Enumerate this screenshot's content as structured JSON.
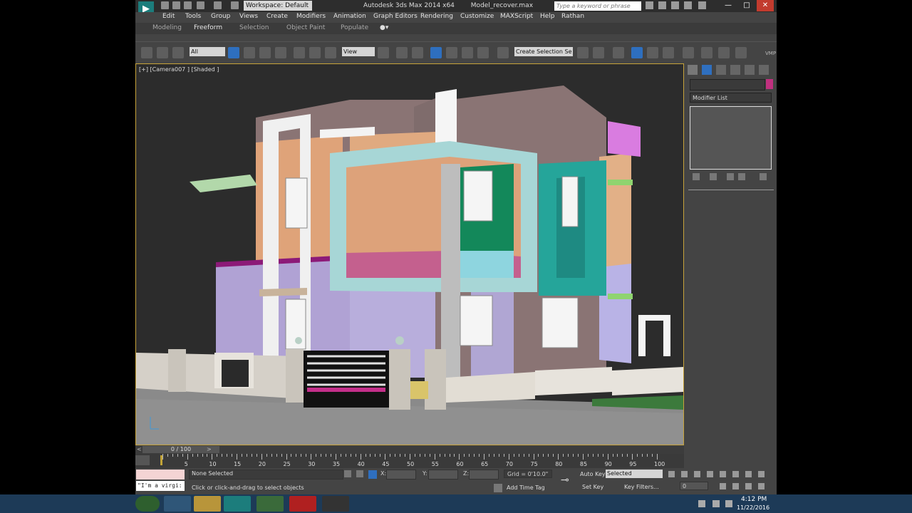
{
  "window": {
    "title": "Autodesk 3ds Max  2014 x64",
    "file": "Model_recover.max",
    "workspace": "Workspace: Default",
    "search_placeholder": "Type a keyword or phrase"
  },
  "menu": [
    "Edit",
    "Tools",
    "Group",
    "Views",
    "Create",
    "Modifiers",
    "Animation",
    "Graph Editors",
    "Rendering",
    "Customize",
    "MAXScript",
    "Help",
    "Rathan"
  ],
  "ribbon_tabs": [
    "Modeling",
    "Freeform",
    "Selection",
    "Object Paint",
    "Populate"
  ],
  "toolbar": {
    "filter": "All",
    "ref_coord": "View",
    "selection_set": "Create Selection Se",
    "vmp_label": "VMP"
  },
  "viewport": {
    "label": "[+] [Camera007 ] [Shaded ]"
  },
  "command_panel": {
    "modifier_list": "Modifier List"
  },
  "timeline": {
    "frame_display": "0 / 100",
    "ticks": [
      "0",
      "5",
      "10",
      "15",
      "20",
      "25",
      "30",
      "35",
      "40",
      "45",
      "50",
      "55",
      "60",
      "65",
      "70",
      "75",
      "80",
      "85",
      "90",
      "95",
      "100"
    ]
  },
  "status": {
    "selection": "None Selected",
    "prompt": "Click or click-and-drag to select objects",
    "script_text": "\"I'm a virgi:",
    "x_label": "X:",
    "y_label": "Y:",
    "z_label": "Z:",
    "grid": "Grid = 0'10.0\"",
    "add_time_tag": "Add Time Tag",
    "auto_key": "Auto Key",
    "selected": "Selected",
    "set_key": "Set Key",
    "key_filters": "Key Filters...",
    "frame": "0"
  },
  "taskbar": {
    "time": "4:12 PM",
    "date": "11/22/2016"
  }
}
